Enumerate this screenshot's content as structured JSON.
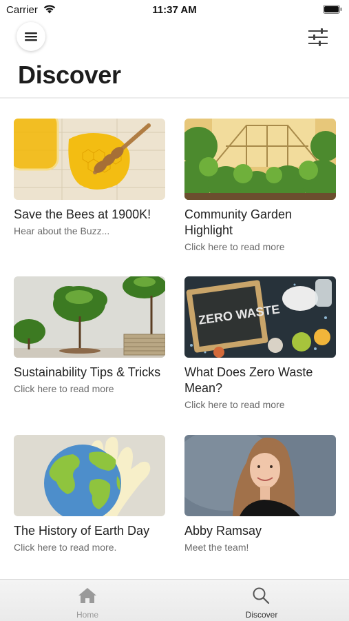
{
  "status": {
    "carrier": "Carrier",
    "time": "11:37 AM"
  },
  "header": {
    "title": "Discover"
  },
  "cards": [
    {
      "title": "Save the Bees at 1900K!",
      "subtitle": "Hear about the Buzz..."
    },
    {
      "title": "Community Garden Highlight",
      "subtitle": "Click here to read more"
    },
    {
      "title": "Sustainability Tips & Tricks",
      "subtitle": "Click here to read more"
    },
    {
      "title": "What Does Zero Waste Mean?",
      "subtitle": "Click here to read more",
      "image_text": "ZERO WASTE"
    },
    {
      "title": "The History of Earth Day",
      "subtitle": "Click here to read more."
    },
    {
      "title": "Abby Ramsay",
      "subtitle": "Meet the team!"
    }
  ],
  "tabs": [
    {
      "label": "Home",
      "icon": "home-icon",
      "active": false
    },
    {
      "label": "Discover",
      "icon": "search-icon",
      "active": true
    }
  ],
  "colors": {
    "active_tab": "#333333",
    "inactive_tab": "#9a9a9a"
  }
}
